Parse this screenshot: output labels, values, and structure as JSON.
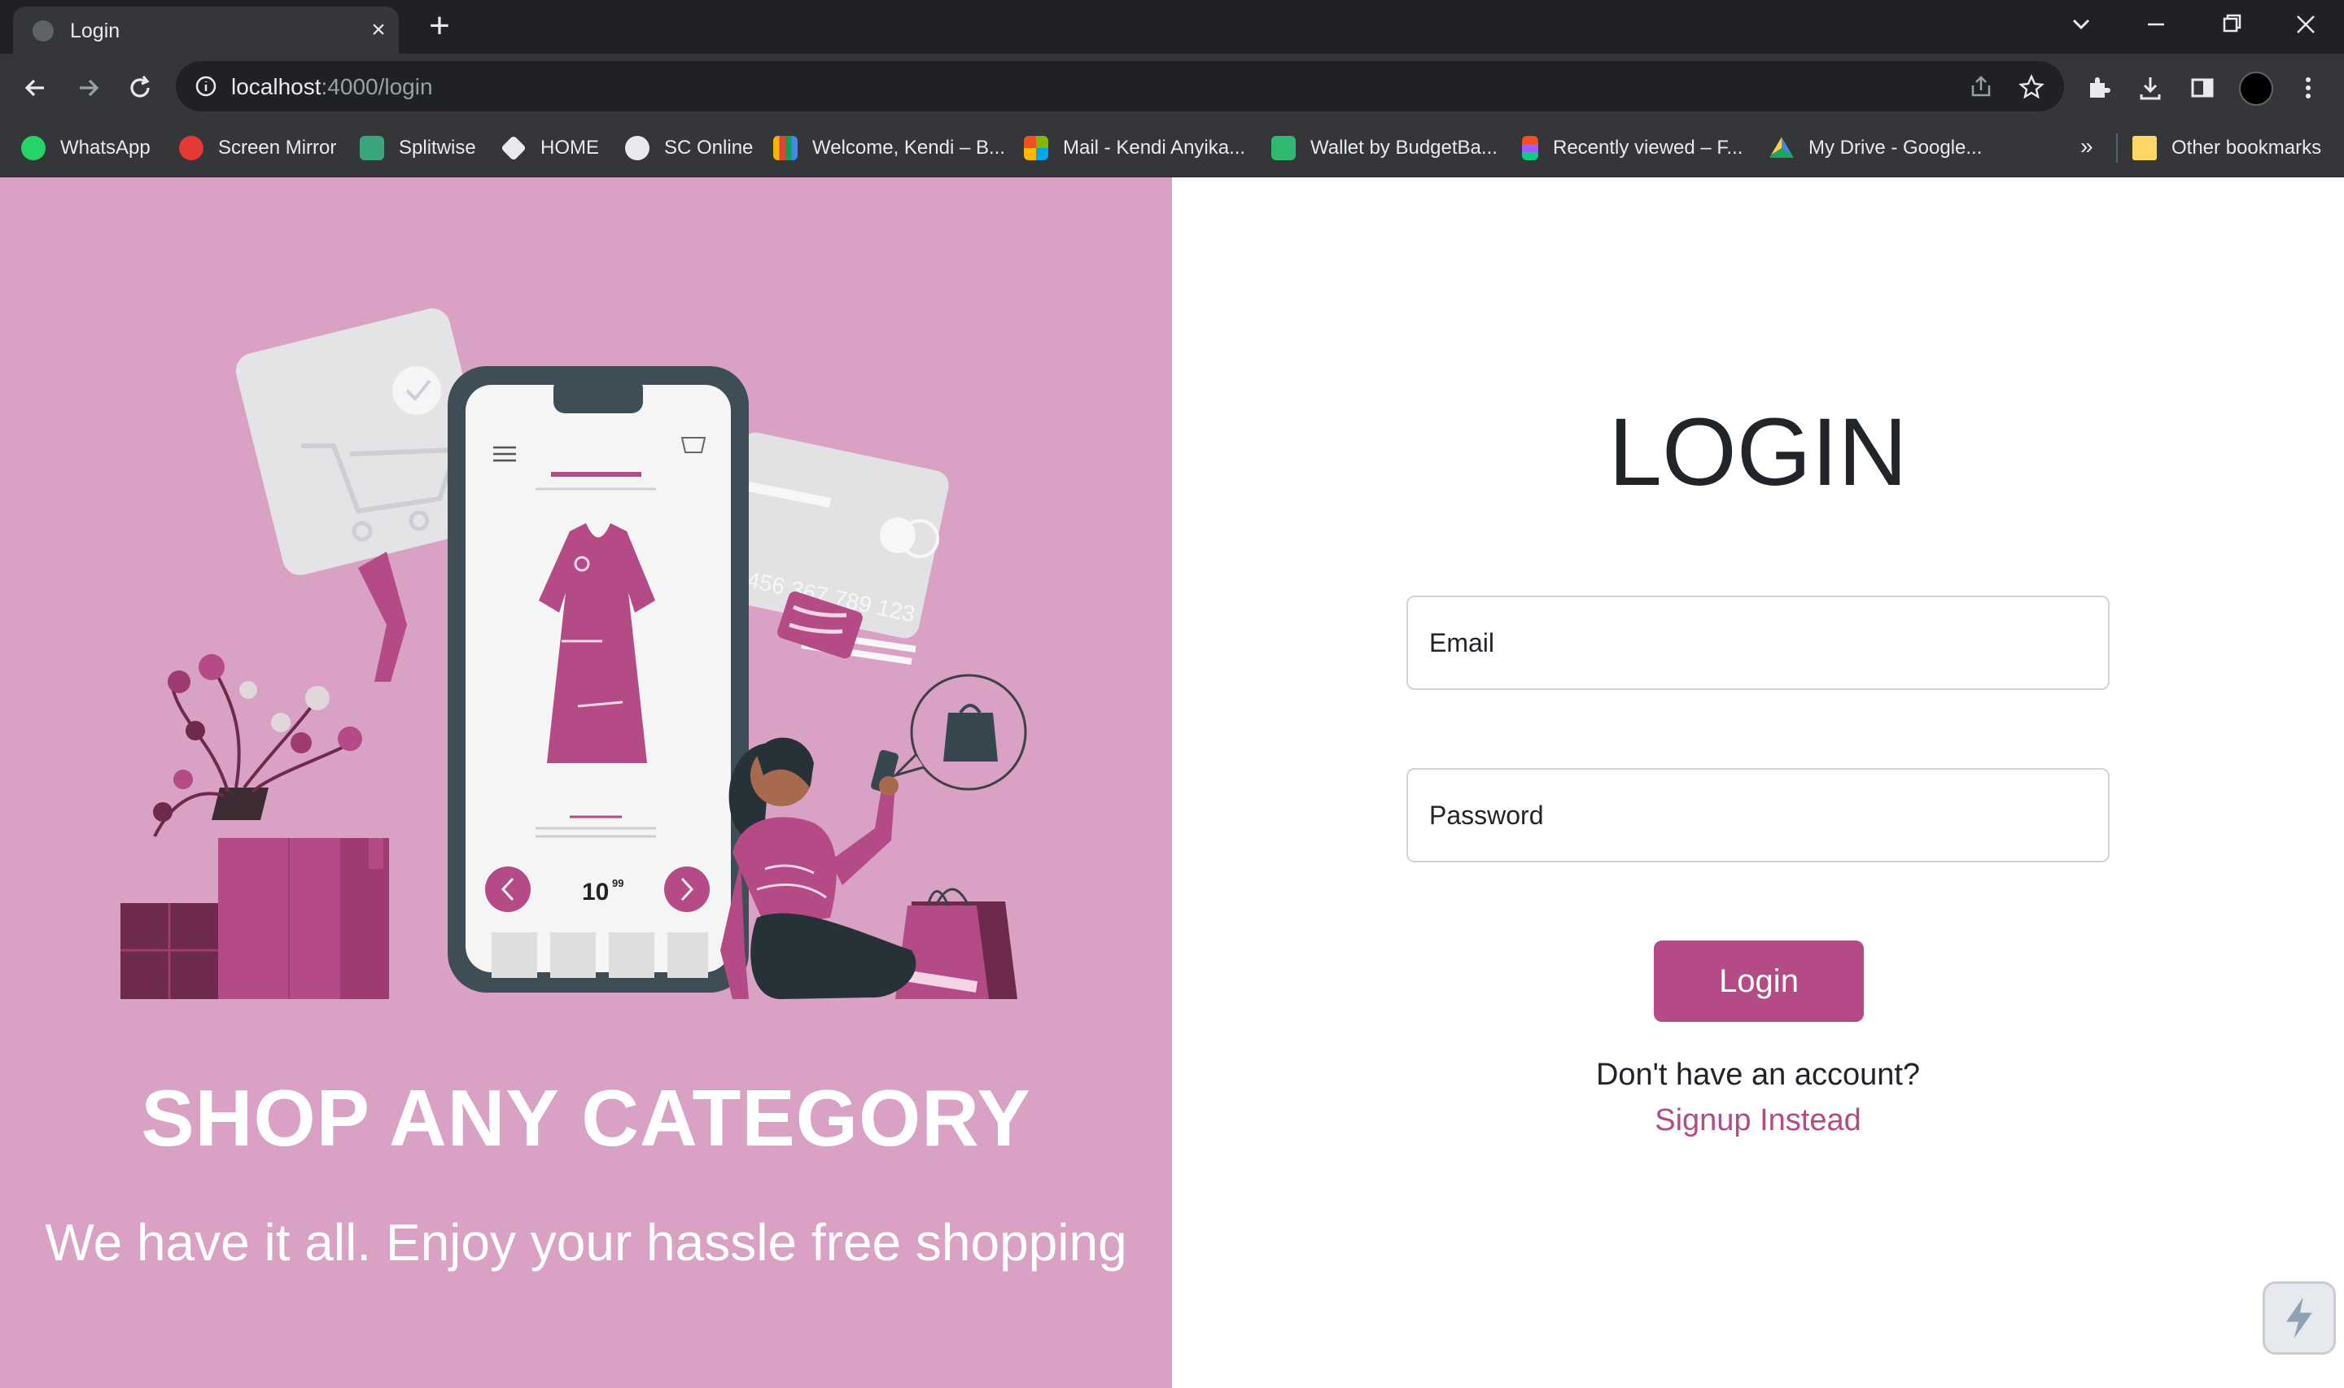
{
  "browser": {
    "tab_title": "Login",
    "url_host": "localhost",
    "url_path": ":4000/login",
    "bookmarks": [
      {
        "label": "WhatsApp",
        "color": "#25d366"
      },
      {
        "label": "Screen Mirror",
        "color": "#e53935"
      },
      {
        "label": "Splitwise",
        "color": "#3aa57a"
      },
      {
        "label": "HOME",
        "color": "#e8eaed"
      },
      {
        "label": "SC Online",
        "color": "#e8eaed"
      },
      {
        "label": "Welcome, Kendi – B...",
        "color": "#f4b400"
      },
      {
        "label": "Mail - Kendi Anyika...",
        "color": "#f25022"
      },
      {
        "label": "Wallet by BudgetBa...",
        "color": "#2eb872"
      },
      {
        "label": "Recently viewed – F...",
        "color": "#a259ff"
      },
      {
        "label": "My Drive - Google...",
        "color": "#1fa463"
      }
    ],
    "more_bookmarks": "»",
    "other_bookmarks": "Other bookmarks"
  },
  "hero": {
    "title": "SHOP ANY CATEGORY",
    "subtitle": "We have it all. Enjoy your hassle free shopping",
    "phone_price": "10",
    "phone_price_cents": "99",
    "card_number": "456 367 789 123",
    "accent_color": "#b44a86",
    "bg_color": "#d9a1c3"
  },
  "login": {
    "title": "LOGIN",
    "email_placeholder": "Email",
    "password_placeholder": "Password",
    "button_label": "Login",
    "no_account_text": "Don't have an account?",
    "signup_link": "Signup Instead"
  }
}
